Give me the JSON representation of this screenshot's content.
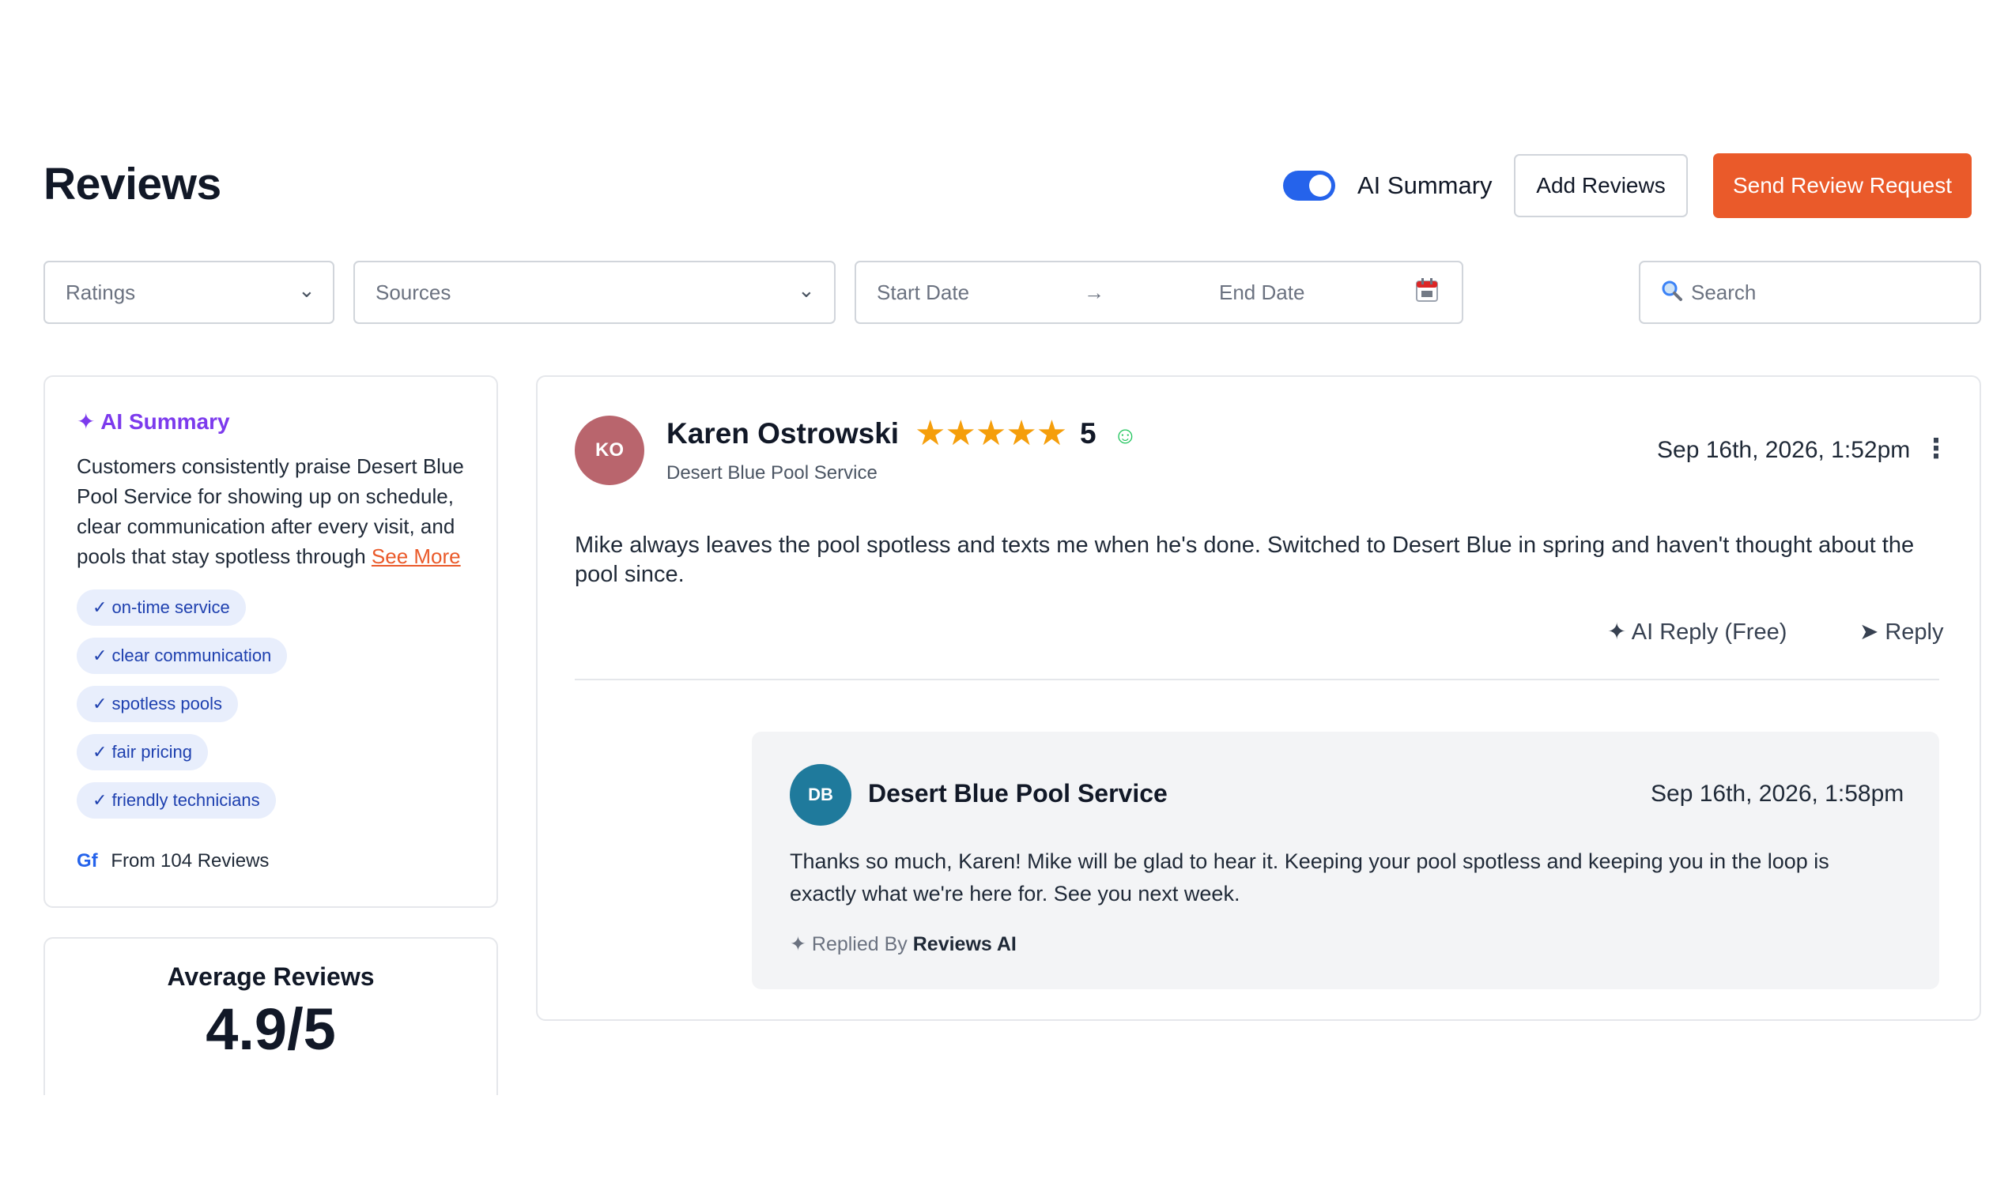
{
  "header": {
    "title": "Reviews",
    "ai_toggle_label": "AI Summary",
    "ai_toggle_on": true,
    "add_reviews_label": "Add Reviews",
    "send_request_label": "Send Review Request"
  },
  "filters": {
    "ratings_placeholder": "Ratings",
    "sources_placeholder": "Sources",
    "start_date_placeholder": "Start Date",
    "date_arrow": "→",
    "end_date_placeholder": "End Date",
    "search_placeholder": "Search"
  },
  "ai_summary": {
    "heading": "✦ AI Summary",
    "text": "Customers consistently praise Desert Blue Pool Service for showing up on schedule, clear communication after every visit, and pools that stay spotless through",
    "see_more": "See More",
    "chips": [
      "✓ on-time service",
      "✓ clear communication",
      "✓ spotless pools",
      "✓ fair pricing",
      "✓ friendly technicians"
    ],
    "source_mark": "Gf",
    "from_text": "From 104 Reviews"
  },
  "average": {
    "title": "Average Reviews",
    "value": "4.9/5"
  },
  "review": {
    "avatar_initials": "KO",
    "avatar_color": "#b9656d",
    "name": "Karen Ostrowski",
    "stars": "★★★★★",
    "rating": 5,
    "rating_text": "5",
    "sentiment_icon": "smile-icon",
    "business": "Desert Blue Pool Service",
    "date": "Sep 16th, 2026, 1:52pm",
    "text": "Mike always leaves the pool spotless and texts me when he's done. Switched to Desert Blue in spring and haven't thought about the pool since.",
    "ai_reply_label": "✦ AI Reply (Free)",
    "reply_label": "➤ Reply",
    "reply": {
      "avatar_initials": "DB",
      "avatar_color": "#1f7a9c",
      "owner": "Desert Blue Pool Service",
      "date": "Sep 16th, 2026, 1:58pm",
      "text": "Thanks so much, Karen! Mike will be glad to hear it. Keeping your pool spotless and keeping you in the loop is exactly what we're here for. See you next week.",
      "replied_by_prefix": "✦ Replied By",
      "replied_by_name": "Reviews AI"
    }
  },
  "colors": {
    "accent": "#ea5a2a",
    "toggle": "#2563eb",
    "ai": "#7c3aed",
    "star": "#f59e0b"
  }
}
